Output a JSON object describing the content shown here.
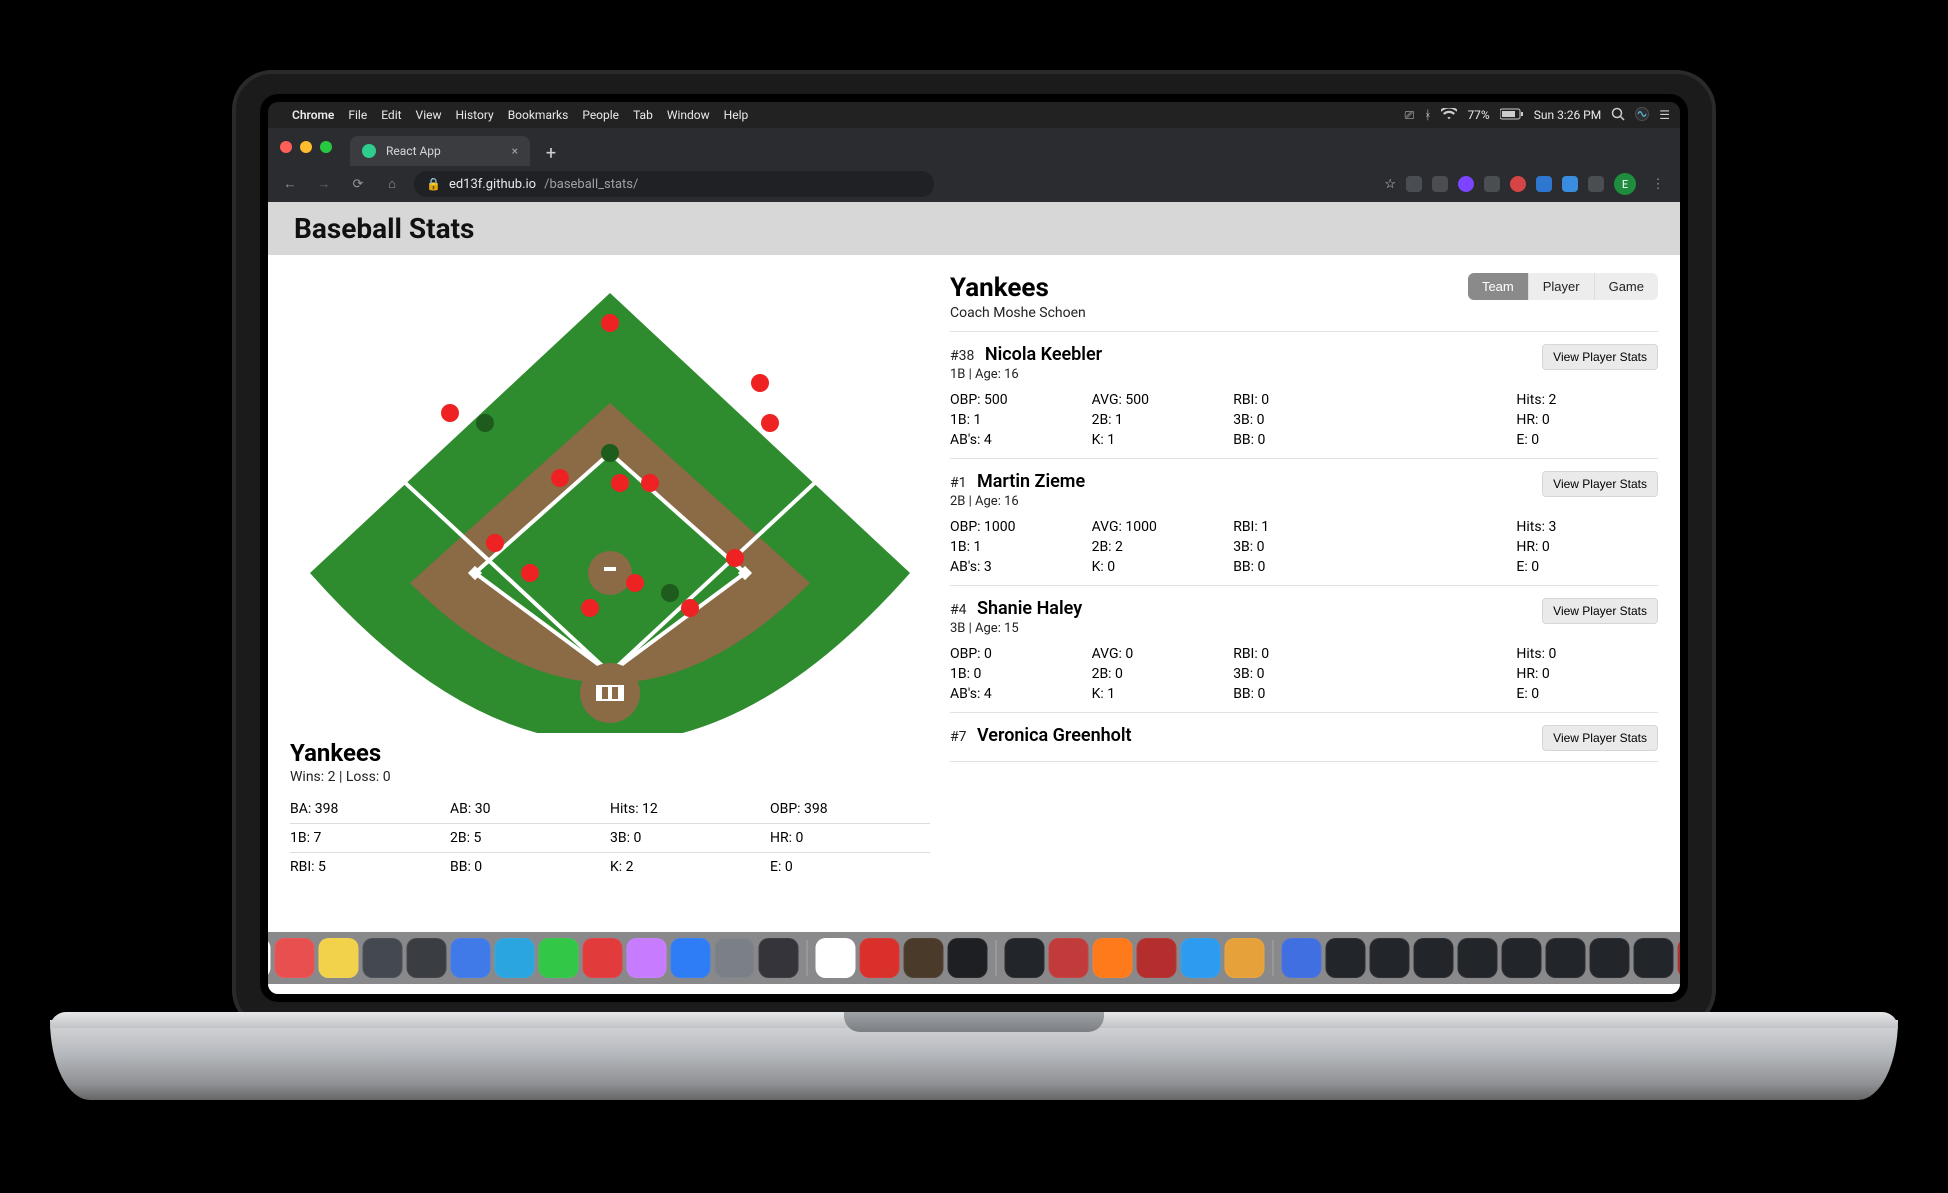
{
  "menubar": {
    "app": "Chrome",
    "items": [
      "File",
      "Edit",
      "View",
      "History",
      "Bookmarks",
      "People",
      "Tab",
      "Window",
      "Help"
    ],
    "battery": "77%",
    "clock": "Sun 3:26 PM"
  },
  "browser": {
    "tab_title": "React App",
    "host": "ed13f.github.io",
    "path": "/baseball_stats/",
    "profile_initial": "E"
  },
  "app": {
    "title": "Baseball Stats",
    "team_name": "Yankees",
    "coach_line": "Coach Moshe Schoen",
    "segments": {
      "team": "Team",
      "player": "Player",
      "game": "Game",
      "active": "Team"
    },
    "view_player_label": "View Player Stats",
    "team_summary": {
      "name": "Yankees",
      "record": "Wins: 2 | Loss: 0",
      "rows": [
        [
          "BA: 398",
          "AB: 30",
          "Hits: 12",
          "OBP: 398"
        ],
        [
          "1B: 7",
          "2B: 5",
          "3B: 0",
          "HR: 0"
        ],
        [
          "RBI: 5",
          "BB: 0",
          "K: 2",
          "E: 0"
        ]
      ]
    },
    "players": [
      {
        "num": "#38",
        "name": "Nicola Keebler",
        "sub": "1B | Age: 16",
        "stats": [
          "OBP: 500",
          "AVG: 500",
          "RBI: 0",
          "Hits: 2",
          "1B: 1",
          "2B: 1",
          "3B: 0",
          "HR: 0",
          "AB's: 4",
          "K: 1",
          "BB: 0",
          "E: 0"
        ]
      },
      {
        "num": "#1",
        "name": "Martin Zieme",
        "sub": "2B | Age: 16",
        "stats": [
          "OBP: 1000",
          "AVG: 1000",
          "RBI: 1",
          "Hits: 3",
          "1B: 1",
          "2B: 2",
          "3B: 0",
          "HR: 0",
          "AB's: 3",
          "K: 0",
          "BB: 0",
          "E: 0"
        ]
      },
      {
        "num": "#4",
        "name": "Shanie Haley",
        "sub": "3B | Age: 15",
        "stats": [
          "OBP: 0",
          "AVG: 0",
          "RBI: 0",
          "Hits: 0",
          "1B: 0",
          "2B: 0",
          "3B: 0",
          "HR: 0",
          "AB's: 4",
          "K: 1",
          "BB: 0",
          "E: 0"
        ]
      },
      {
        "num": "#7",
        "name": "Veronica Greenholt",
        "sub": "",
        "stats": []
      }
    ]
  },
  "dock_colors": [
    "#1d7ef0",
    "#6b3fb0",
    "#ffffff",
    "#e85050",
    "#f2d24a",
    "#444850",
    "#3a3d42",
    "#4079e8",
    "#2aa5e0",
    "#33c748",
    "#e13b3b",
    "#c77cff",
    "#2e7cf6",
    "#7b7f86",
    "#34343a",
    "#ffffff",
    "#d9302c",
    "#4a3a2a",
    "#1d1f22",
    "#22252a",
    "#c23b3b",
    "#ff7a1a",
    "#b52e2e",
    "#2c9bf0",
    "#e7a13a",
    "#3f6fe0",
    "#22252a",
    "#22252a",
    "#22252a",
    "#22252a",
    "#22252a",
    "#22252a",
    "#22252a",
    "#22252a",
    "#a8322c",
    "#22252a",
    "#5d6167"
  ]
}
